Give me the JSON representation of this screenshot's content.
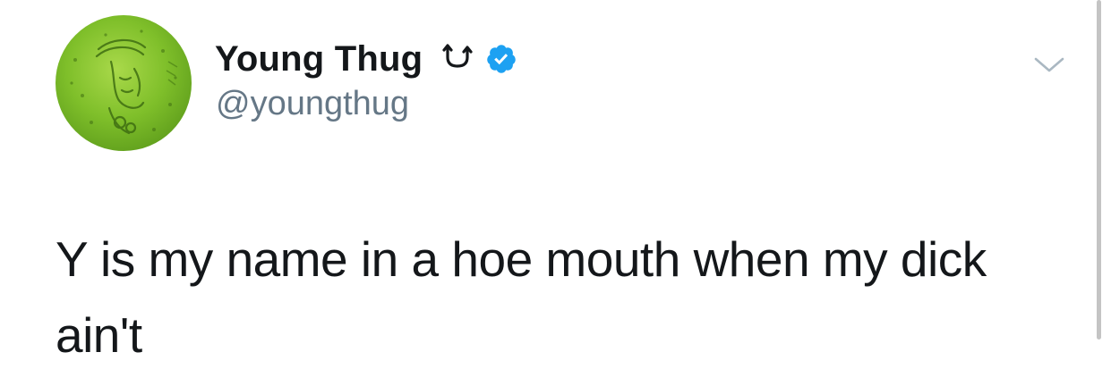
{
  "tweet": {
    "display_name": "Young Thug",
    "name_glyph": "௬U",
    "handle": "@youngthug",
    "verified": true,
    "text": "Y is my name in a hoe mouth when my dick ain't"
  },
  "icons": {
    "avatar": "profile-avatar",
    "verified": "verified-badge-icon",
    "caret": "chevron-down-icon"
  },
  "colors": {
    "text": "#14171a",
    "secondary": "#657786",
    "verified_blue": "#1da1f2",
    "avatar_green": "#7fbf2a",
    "caret": "#aab8c2"
  }
}
